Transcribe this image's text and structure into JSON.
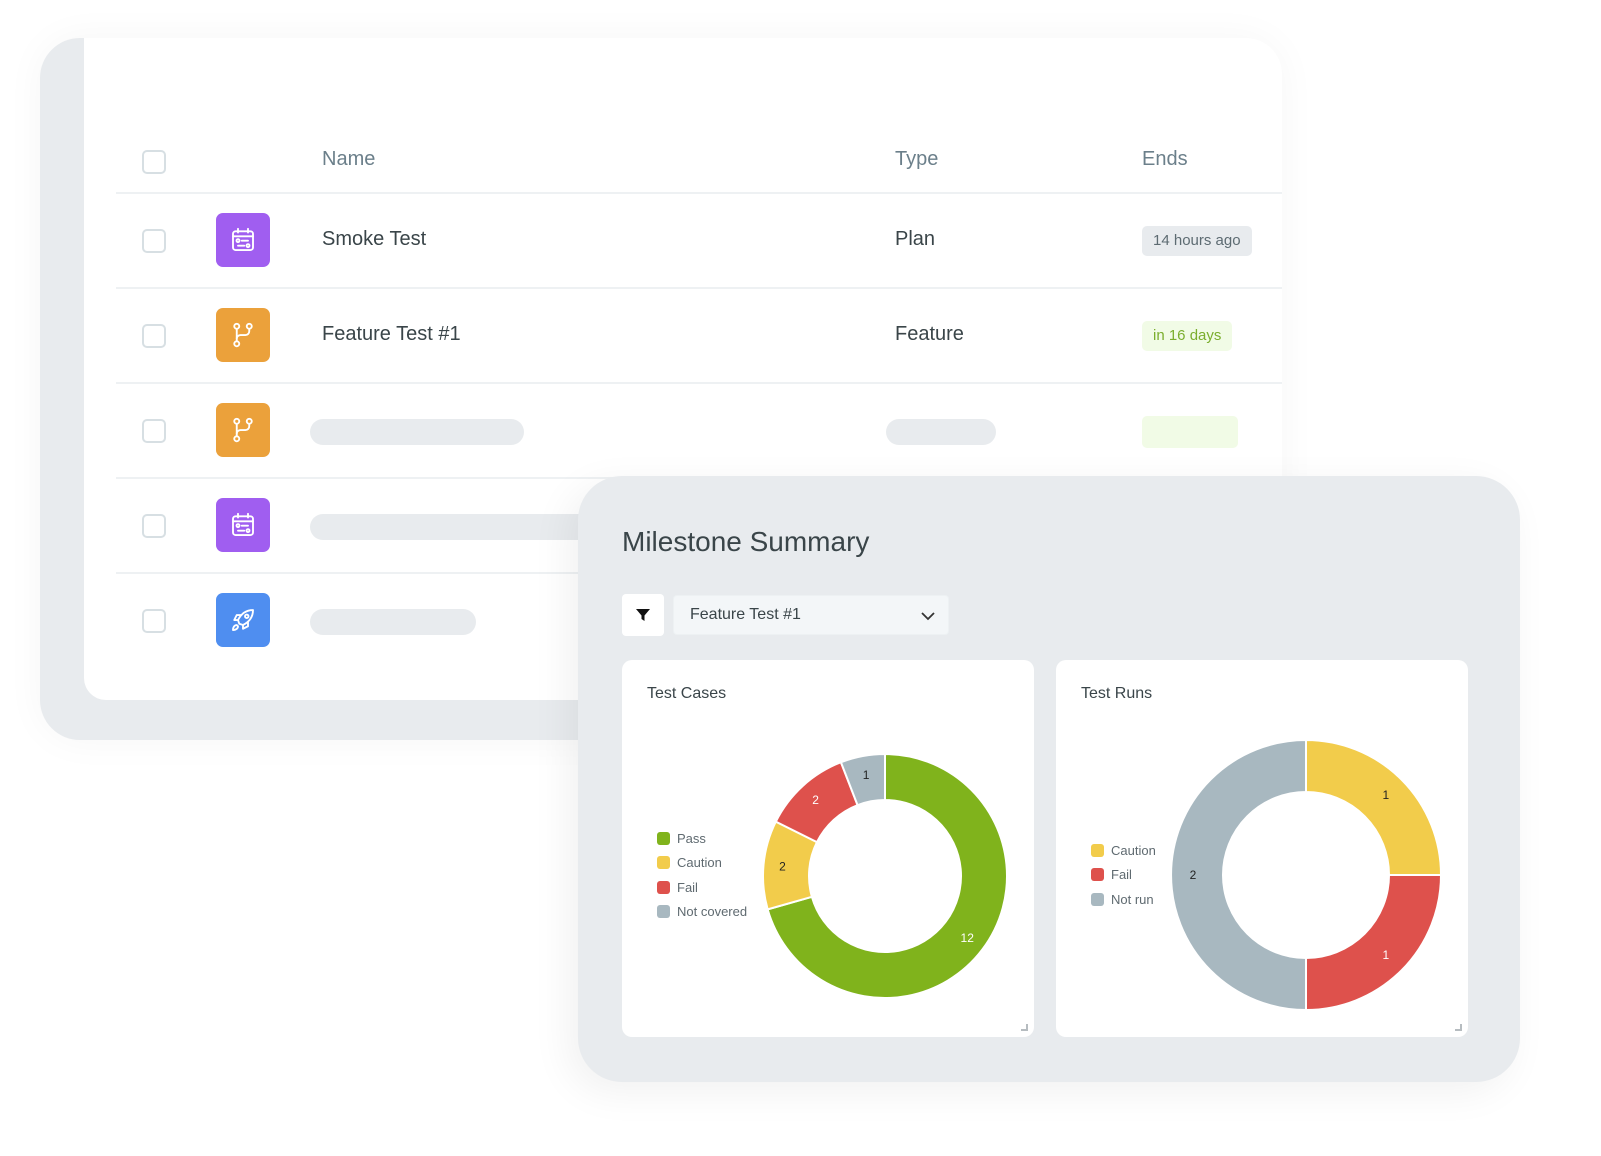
{
  "list": {
    "columns": {
      "name": "Name",
      "type": "Type",
      "ends": "Ends"
    },
    "rows": [
      {
        "icon": "calendar-plan-icon",
        "color": "#a05ef0",
        "name": "Smoke Test",
        "type": "Plan",
        "ends": "14 hours ago",
        "ends_style": "gray"
      },
      {
        "icon": "git-branch-icon",
        "color": "#eba13b",
        "name": "Feature Test #1",
        "type": "Feature",
        "ends": "in 16 days",
        "ends_style": "green"
      },
      {
        "icon": "git-branch-icon",
        "color": "#eba13b",
        "name": null,
        "type": null,
        "ends": null,
        "ends_style": "green"
      },
      {
        "icon": "calendar-plan-icon",
        "color": "#a05ef0",
        "name": null,
        "type": null,
        "ends": null
      },
      {
        "icon": "rocket-icon",
        "color": "#4f8ef0",
        "name": null,
        "type": null,
        "ends": null
      }
    ]
  },
  "summary": {
    "title": "Milestone Summary",
    "filter_icon": "filter-icon",
    "selected_milestone": "Feature Test #1"
  },
  "colors": {
    "pass": "#80b31c",
    "caution": "#f2cc4b",
    "fail": "#de514c",
    "neutral": "#a8b8c0"
  },
  "chart_data": [
    {
      "type": "pie",
      "variant": "donut",
      "title": "Test Cases",
      "legend_position": "left",
      "categories": [
        "Pass",
        "Caution",
        "Fail",
        "Not covered"
      ],
      "values": [
        12,
        2,
        2,
        1
      ],
      "colors": [
        "#80b31c",
        "#f2cc4b",
        "#de514c",
        "#a8b8c0"
      ],
      "label_colors": [
        "#ffffff",
        "#222222",
        "#ffffff",
        "#222222"
      ]
    },
    {
      "type": "pie",
      "variant": "donut",
      "title": "Test Runs",
      "legend_position": "left",
      "categories": [
        "Caution",
        "Fail",
        "Not run"
      ],
      "values": [
        1,
        1,
        2
      ],
      "colors": [
        "#f2cc4b",
        "#de514c",
        "#a8b8c0"
      ],
      "label_colors": [
        "#222222",
        "#ffffff",
        "#222222"
      ]
    }
  ]
}
